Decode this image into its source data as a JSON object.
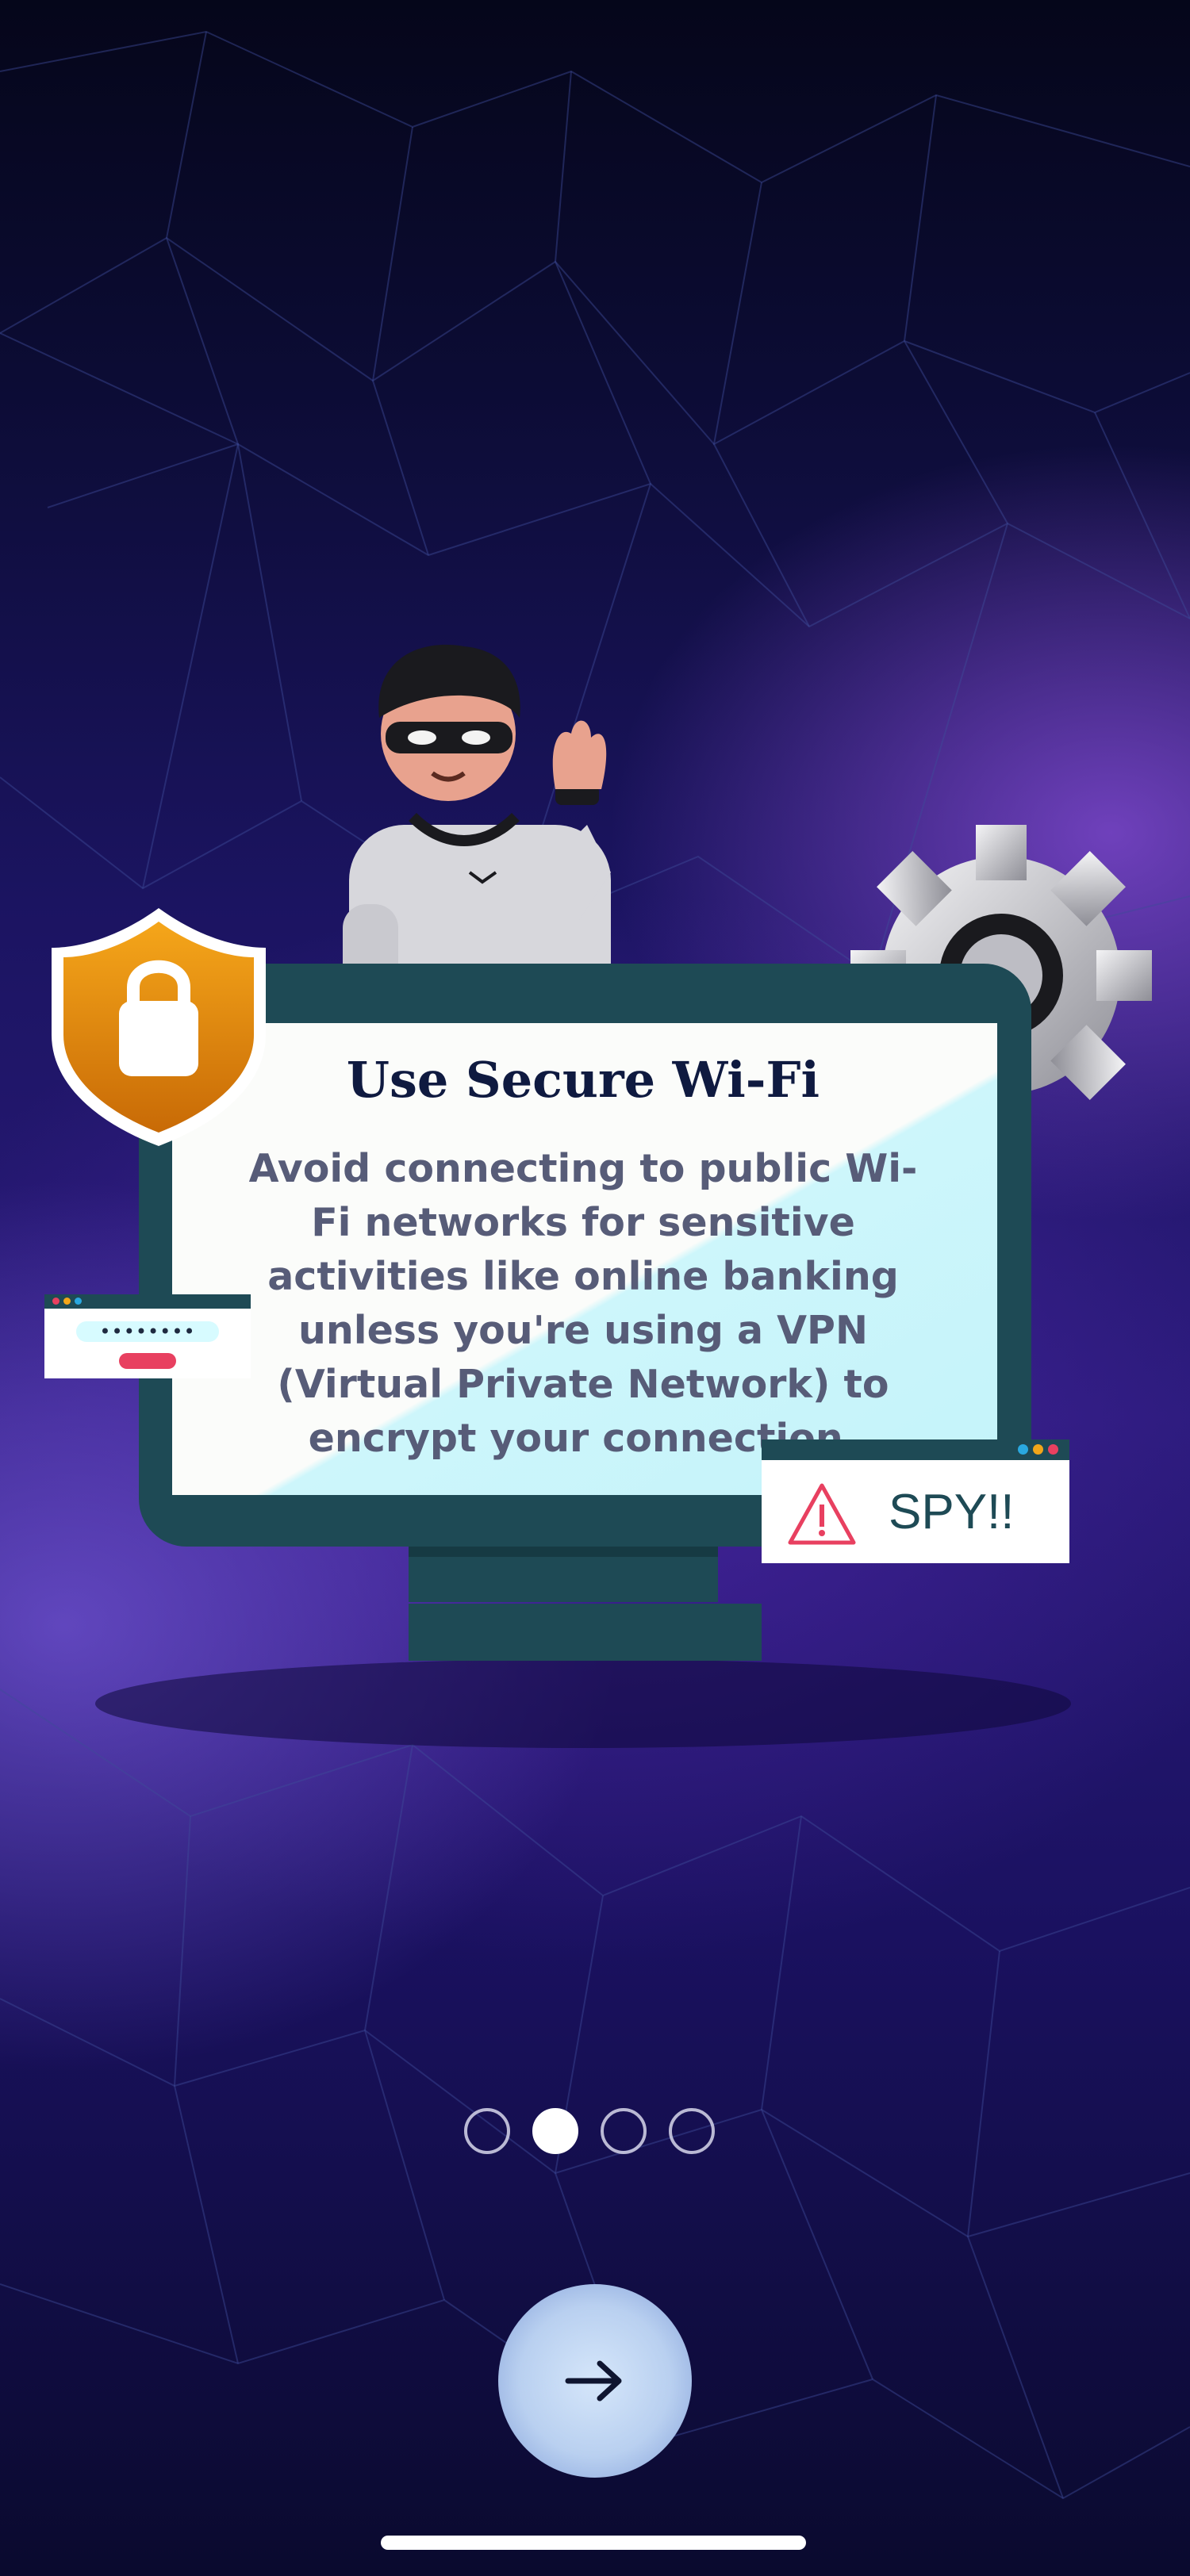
{
  "onboarding": {
    "title": "Use Secure Wi-Fi",
    "body": "Avoid connecting to public Wi-Fi networks for sensitive activities like online banking unless you're using a VPN (Virtual Private Network) to encrypt your connection.",
    "illustration": {
      "spy_alert_text": "SPY!!",
      "password_mask": "••••••••"
    }
  },
  "pager": {
    "total": 4,
    "current": 2
  },
  "next_button": {
    "icon": "arrow-right-icon"
  },
  "colors": {
    "background_dark": "#05061a",
    "background_purple": "#5a32c8",
    "monitor_frame": "#1e4a55",
    "shield_orange": "#f29a0e",
    "alert_red": "#e84060",
    "title_navy": "#0f1a40",
    "body_gray": "#575c78",
    "button_light_blue": "#c2d6f2"
  }
}
